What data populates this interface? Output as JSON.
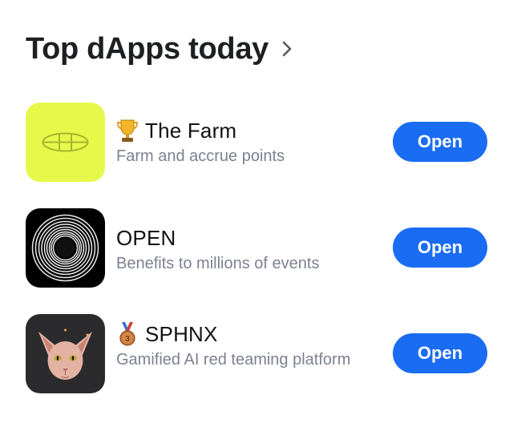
{
  "header": {
    "title": "Top dApps today",
    "chevron_icon": "chevron-right-icon"
  },
  "apps": [
    {
      "emoji_icon": "trophy-icon",
      "name": "The Farm",
      "description": "Farm and accrue points",
      "button_label": "Open",
      "icon_bg": "#e6f94a"
    },
    {
      "emoji_icon": "",
      "name": "OPEN",
      "description": "Benefits to millions of events",
      "button_label": "Open",
      "icon_bg": "#000000"
    },
    {
      "emoji_icon": "third-place-medal-icon",
      "name": "SPHNX",
      "description": "Gamified AI red teaming platform",
      "button_label": "Open",
      "icon_bg": "#2b2b2e"
    }
  ],
  "colors": {
    "accent": "#1a6cf2",
    "secondary_text": "#7c8190"
  }
}
